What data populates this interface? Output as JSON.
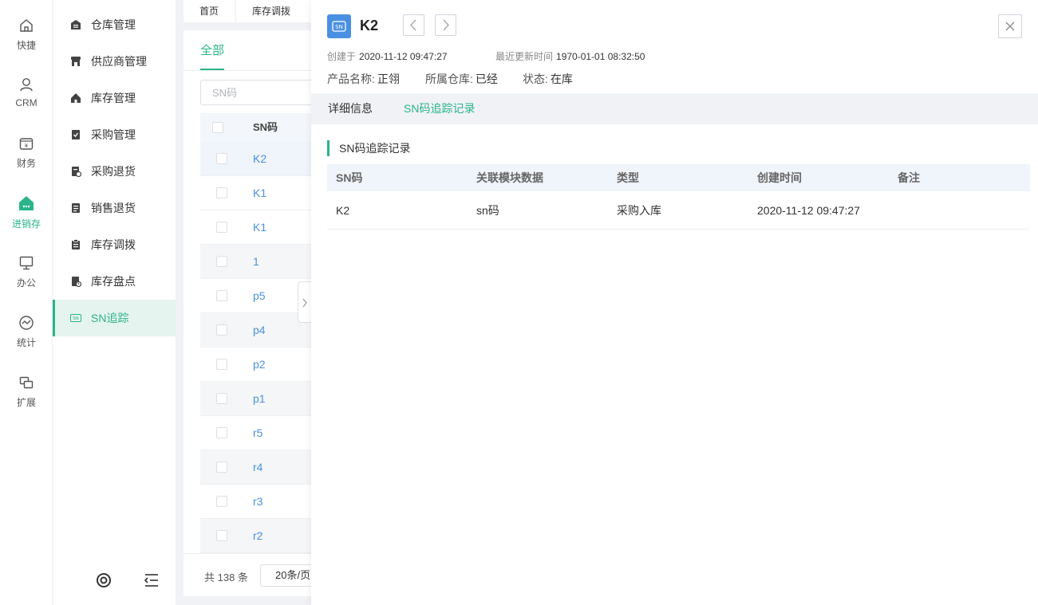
{
  "rail": {
    "items": [
      {
        "label": "快捷",
        "icon": "home-icon"
      },
      {
        "label": "CRM",
        "icon": "user-icon"
      },
      {
        "label": "财务",
        "icon": "wallet-icon"
      },
      {
        "label": "进销存",
        "icon": "inventory-icon",
        "active": true
      },
      {
        "label": "办公",
        "icon": "monitor-icon"
      },
      {
        "label": "统计",
        "icon": "chart-icon"
      },
      {
        "label": "扩展",
        "icon": "extension-icon"
      }
    ]
  },
  "submenu": {
    "items": [
      {
        "label": "仓库管理",
        "icon": "warehouse-icon"
      },
      {
        "label": "供应商管理",
        "icon": "store-icon"
      },
      {
        "label": "库存管理",
        "icon": "house-icon"
      },
      {
        "label": "采购管理",
        "icon": "purchase-doc-icon"
      },
      {
        "label": "采购退货",
        "icon": "purchase-return-icon"
      },
      {
        "label": "销售退货",
        "icon": "sales-return-icon"
      },
      {
        "label": "库存调拨",
        "icon": "transfer-icon"
      },
      {
        "label": "库存盘点",
        "icon": "stocktake-icon"
      },
      {
        "label": "SN追踪",
        "icon": "sn-icon",
        "active": true
      }
    ]
  },
  "top_tabs": [
    "首页",
    "库存调拨"
  ],
  "list": {
    "tab_all": "全部",
    "search_placeholder": "SN码",
    "column_header": "SN码",
    "rows": [
      "K2",
      "K1",
      "K1",
      "1",
      "p5",
      "p4",
      "p2",
      "p1",
      "r5",
      "r4",
      "r3",
      "r2"
    ],
    "total": "共 138 条",
    "page_size": "20条/页"
  },
  "drawer": {
    "badge": "SN",
    "title": "K2",
    "created_label": "创建于",
    "created_value": "2020-11-12 09:47:27",
    "updated_label": "最近更新时间",
    "updated_value": "1970-01-01 08:32:50",
    "product_label": "产品名称:",
    "product_value": "正翎",
    "warehouse_label": "所属仓库:",
    "warehouse_value": "已经",
    "status_label": "状态:",
    "status_value": "在库",
    "tabs": {
      "detail": "详细信息",
      "trace": "SN码追踪记录"
    },
    "section_title": "SN码追踪记录",
    "table": {
      "headers": [
        "SN码",
        "关联模块数据",
        "类型",
        "创建时间",
        "备注"
      ],
      "rows": [
        [
          "K2",
          "sn码",
          "采购入库",
          "2020-11-12 09:47:27",
          ""
        ]
      ]
    }
  },
  "colors": {
    "accent": "#2bb48b",
    "link": "#4a90e2"
  }
}
